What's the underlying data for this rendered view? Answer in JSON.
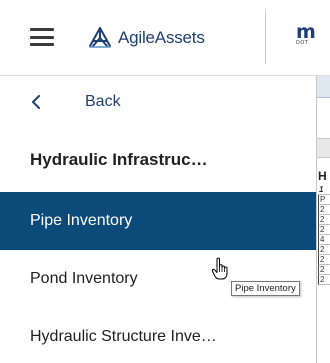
{
  "header": {
    "logo_text": "AgileAssets",
    "partner_logo_main": "m",
    "partner_logo_sub": "DOT"
  },
  "sidebar": {
    "back_label": "Back",
    "section_title": "Hydraulic Infrastruc…",
    "items": [
      {
        "label": "Pipe Inventory",
        "active": true
      },
      {
        "label": "Pond Inventory",
        "active": false
      },
      {
        "label": "Hydraulic Structure Inve…",
        "active": false
      }
    ]
  },
  "content_edge": {
    "heading_fragment": "H",
    "row_fragments": [
      "1",
      "P",
      "2",
      "2",
      "2",
      "4",
      "2",
      "2",
      "2",
      "2"
    ]
  },
  "tooltip": "Pipe Inventory",
  "colors": {
    "brand_blue": "#1f3f73",
    "active_item_bg": "#0c4a7a",
    "active_item_text": "#ffffff"
  },
  "icons": {
    "menu": "hamburger-menu-icon",
    "logo": "agileassets-logo-icon",
    "back": "chevron-left-icon",
    "cursor": "hand-pointer-cursor-icon"
  }
}
